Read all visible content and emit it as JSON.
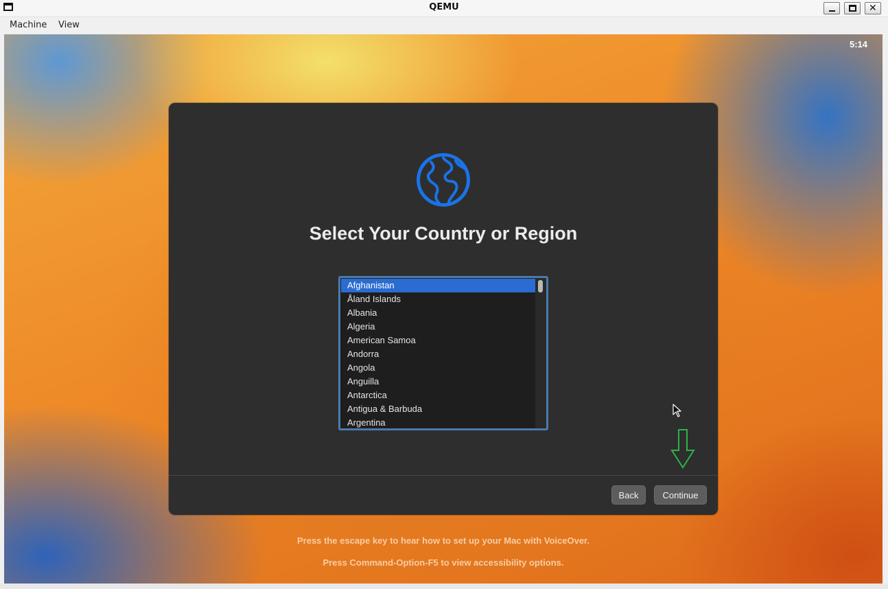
{
  "window": {
    "title": "QEMU"
  },
  "menubar": {
    "items": [
      "Machine",
      "View"
    ]
  },
  "guest": {
    "clock": "5:14",
    "dialog": {
      "title": "Select Your Country or Region",
      "icon": "globe-icon",
      "countries": [
        "Afghanistan",
        "Åland Islands",
        "Albania",
        "Algeria",
        "American Samoa",
        "Andorra",
        "Angola",
        "Anguilla",
        "Antarctica",
        "Antigua & Barbuda",
        "Argentina"
      ],
      "selected": "Afghanistan",
      "back_label": "Back",
      "continue_label": "Continue"
    },
    "footer": {
      "line1": "Press the escape key to hear how to set up your Mac with VoiceOver.",
      "line2": "Press Command-Option-F5 to view accessibility options."
    }
  },
  "colors": {
    "selection": "#2a6cd1",
    "globe": "#1a73e8",
    "hint_arrow": "#2bb34a",
    "dialog_bg": "#2e2e2e"
  }
}
